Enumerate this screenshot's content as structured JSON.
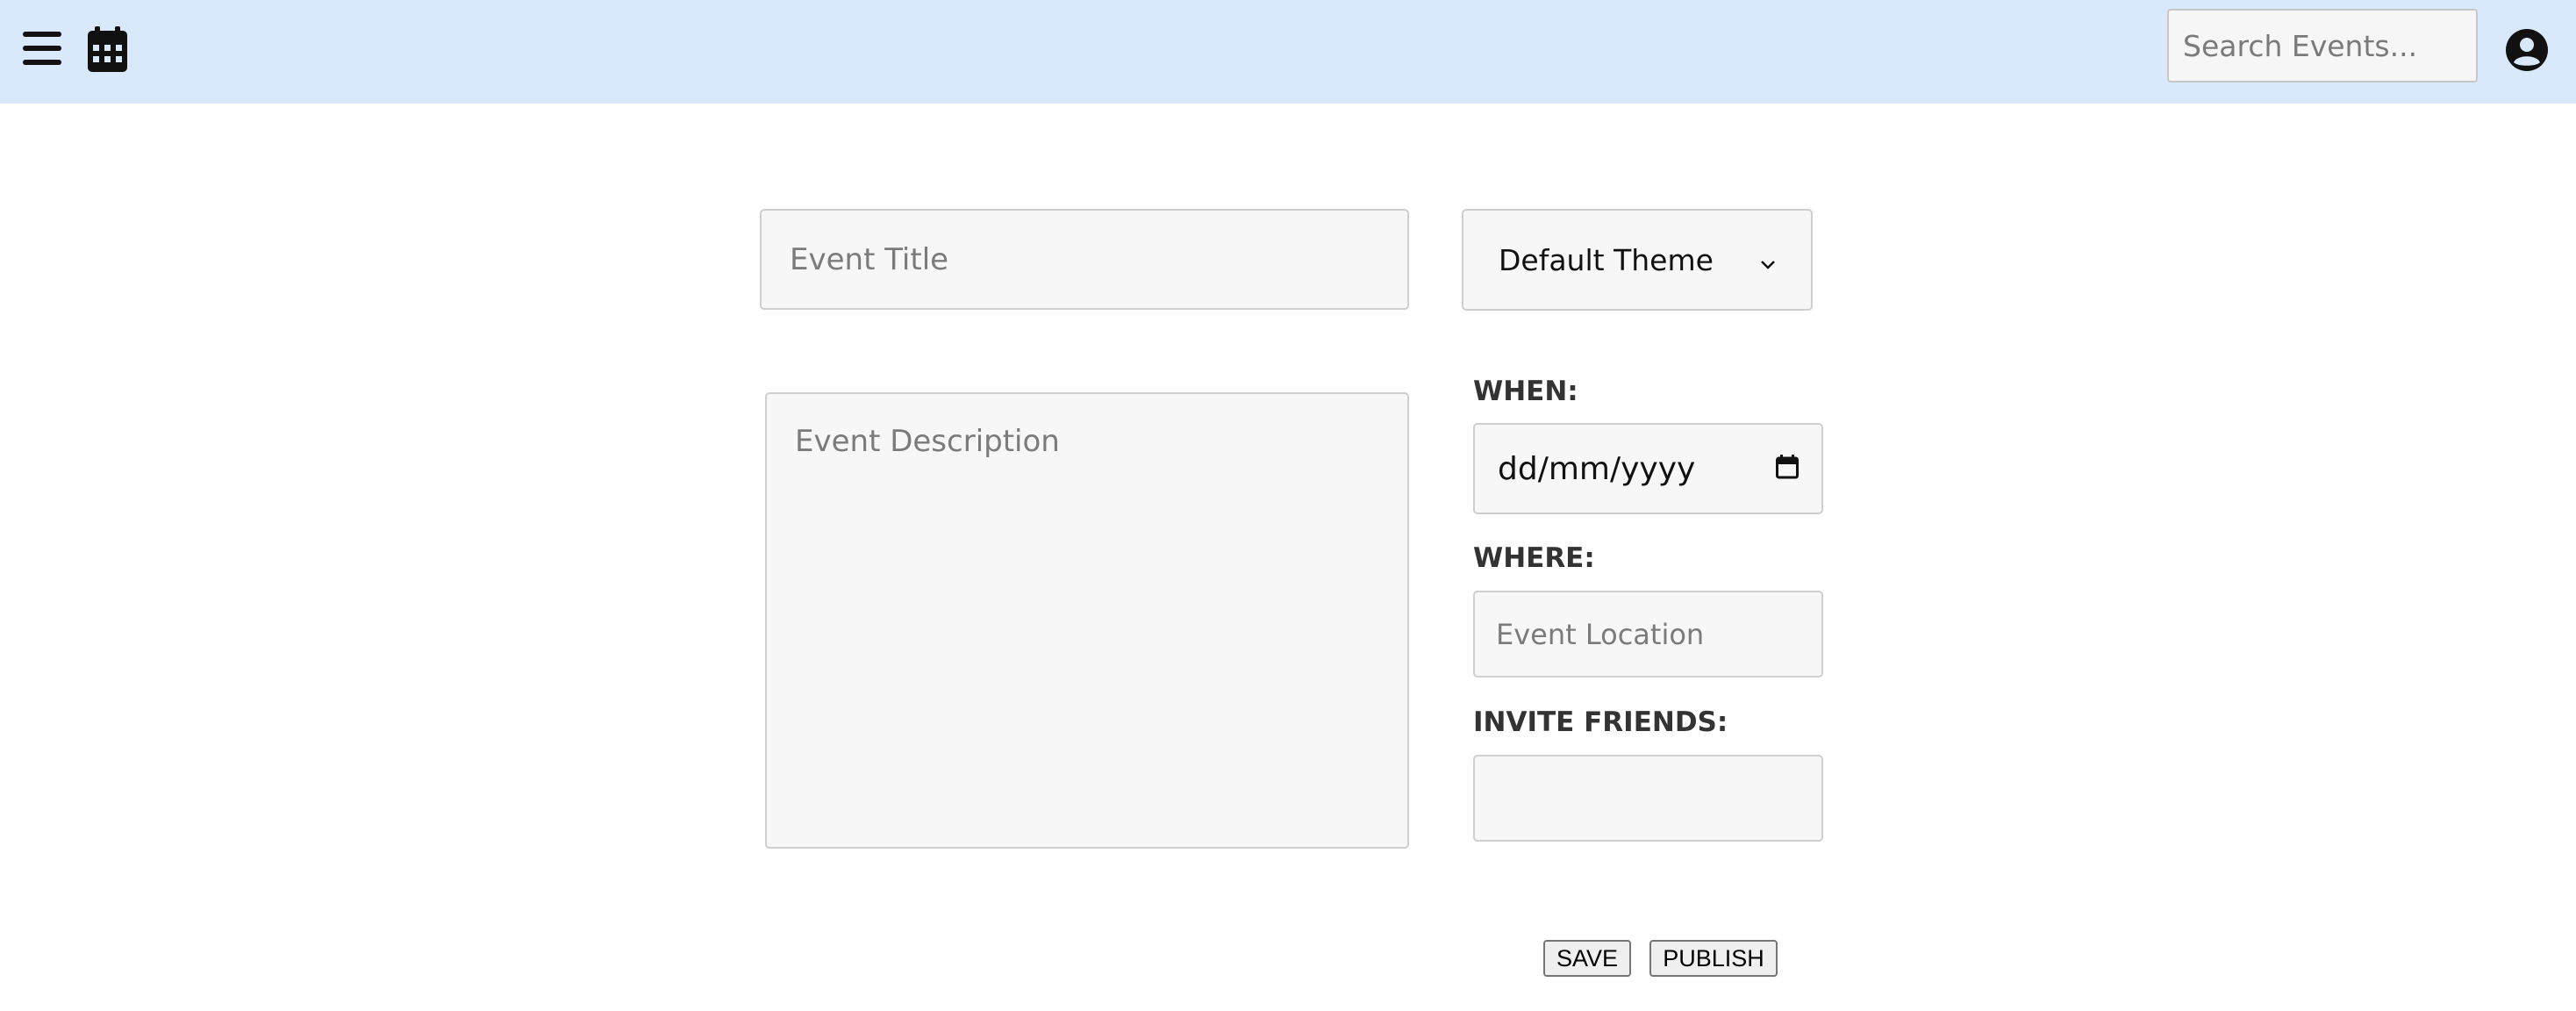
{
  "header": {
    "search_placeholder": "Search Events...",
    "icons": [
      "hamburger-menu-icon",
      "calendar-icon",
      "user-avatar-icon"
    ],
    "background_color": "#d9e8fb"
  },
  "form": {
    "title_placeholder": "Event Title",
    "theme_selected": "Default Theme",
    "description_placeholder": "Event Description",
    "when_label": "WHEN:",
    "date_placeholder": "dd/mm/yyyy",
    "where_label": "WHERE:",
    "location_placeholder": "Event Location",
    "invite_label": "INVITE FRIENDS:",
    "invite_value": ""
  },
  "actions": {
    "save_label": "SAVE",
    "publish_label": "PUBLISH"
  }
}
